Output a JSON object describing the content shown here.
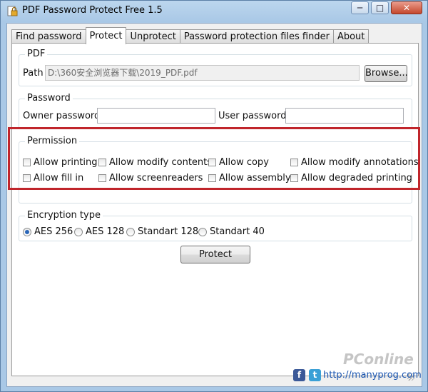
{
  "window": {
    "title": "PDF Password Protect Free 1.5"
  },
  "title_controls": {
    "minimize": "─",
    "maximize": "□",
    "close": "✕"
  },
  "tabs": [
    "Find password",
    "Protect",
    "Unprotect",
    "Password protection files finder",
    "About"
  ],
  "active_tab": "Protect",
  "pdf_group": {
    "legend": "PDF",
    "path_label": "Path",
    "path_value": "D:\\360安全浏览器下载\\2019_PDF.pdf",
    "browse_label": "Browse..."
  },
  "password_group": {
    "legend": "Password",
    "owner_label": "Owner password",
    "owner_value": "",
    "user_label": "User password",
    "user_value": ""
  },
  "permission_group": {
    "legend": "Permission",
    "items": [
      "Allow printing",
      "Allow modify contents",
      "Allow copy",
      "Allow modify annotations",
      "Allow fill in",
      "Allow screenreaders",
      "Allow assembly",
      "Allow degraded printing"
    ]
  },
  "encryption_group": {
    "legend": "Encryption type",
    "options": [
      "AES 256",
      "AES 128",
      "Standart 128",
      "Standart 40"
    ],
    "selected": "AES 256"
  },
  "protect_button": "Protect",
  "footer": {
    "facebook_icon": "f",
    "twitter_icon": "t",
    "link": "http://manyprog.com"
  },
  "watermark": "PConline",
  "colors": {
    "highlight": "#c0252b",
    "link": "#1a55b0",
    "facebook": "#3b5998",
    "twitter": "#3aa0d6"
  }
}
